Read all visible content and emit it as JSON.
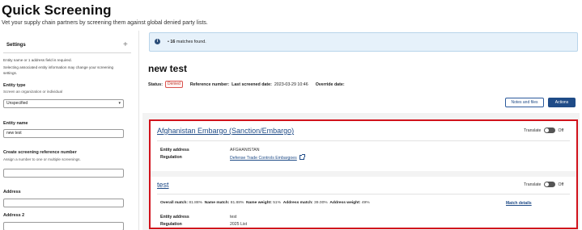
{
  "page": {
    "title": "Quick Screening",
    "subtitle": "Vet your supply chain partners by screening them against global denied party lists."
  },
  "settings": {
    "header": "Settings",
    "plus_glyph": "+",
    "hint_lines": [
      "Entity name or 1 address field is required.",
      "Selecting associated entity information may change your screening",
      "settings."
    ],
    "entity_type": {
      "label": "Entity type",
      "sub": "Screen an organization or individual",
      "value": "Unspecified"
    },
    "entity_name": {
      "label": "Entity name",
      "value": "new test"
    },
    "reference": {
      "label": "Create screening reference number",
      "sub": "Assign a number to one or multiple screenings.",
      "value": ""
    },
    "address": {
      "label": "Address",
      "value": ""
    },
    "address2": {
      "label": "Address 2",
      "value": ""
    }
  },
  "notice": {
    "icon_glyph": "i",
    "bullet": "•",
    "count": "16",
    "text": "matches found."
  },
  "result": {
    "title": "new test",
    "status_label": "Status:",
    "status_value": "Denied",
    "reference_label": "Reference number:",
    "last_screened_label": "Last screened date:",
    "last_screened_value": "2023-03-29 10:46",
    "override_label": "Override date:",
    "notes_button": "Notes and files",
    "actions_button": "Actions"
  },
  "cards": [
    {
      "title": "Afghanistan Embargo (Sanction/Embargo)",
      "translate_label": "Translate",
      "toggle_state": "Off",
      "entity_address_label": "Entity address",
      "entity_address_value": "AFGHANISTAN",
      "regulation_label": "Regulation",
      "regulation_value": "Defense Trade Controls Embargoes"
    },
    {
      "title": "test",
      "translate_label": "Translate",
      "toggle_state": "Off",
      "metrics": [
        {
          "label": "Overall match:",
          "value": "81.88%"
        },
        {
          "label": "Name match:",
          "value": "81.88%"
        },
        {
          "label": "Name weight:",
          "value": "51%"
        },
        {
          "label": "Address match:",
          "value": "39.00%"
        },
        {
          "label": "Address weight:",
          "value": "49%"
        }
      ],
      "match_details": "Match details",
      "entity_address_label": "Entity address",
      "entity_address_value": "test",
      "regulation_label": "Regulation",
      "regulation_value": "2025 List"
    }
  ],
  "colors": {
    "accent": "#1f4b87",
    "highlight_border": "#d1121b",
    "notice_bg": "#e6f1fa",
    "denied": "#c0392b"
  },
  "icons": {
    "info": "info-icon",
    "external": "external-link-icon",
    "chevron": "chevron-down-icon",
    "plus": "plus-icon"
  }
}
